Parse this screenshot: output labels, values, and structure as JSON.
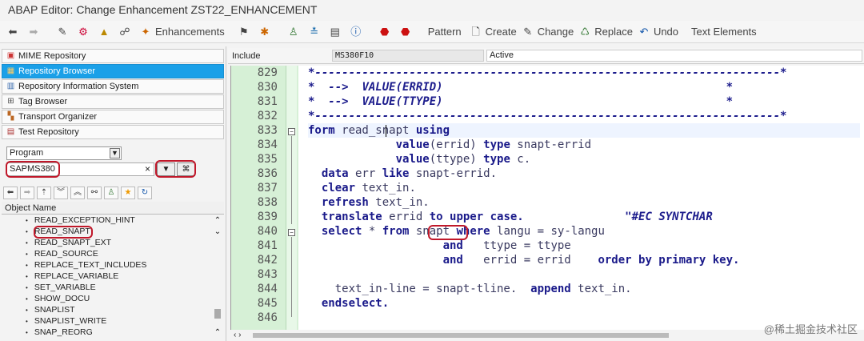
{
  "window": {
    "title": "ABAP Editor: Change Enhancement ZST22_ENHANCEMENT"
  },
  "toolbar": {
    "enhancements": "Enhancements",
    "pattern": "Pattern",
    "create": "Create",
    "change": "Change",
    "replace": "Replace",
    "undo": "Undo",
    "text_elements": "Text Elements"
  },
  "nav": [
    {
      "label": "MIME Repository",
      "icon": "mime-icon"
    },
    {
      "label": "Repository Browser",
      "icon": "repository-icon"
    },
    {
      "label": "Repository Information System",
      "icon": "info-system-icon"
    },
    {
      "label": "Tag Browser",
      "icon": "tag-icon"
    },
    {
      "label": "Transport Organizer",
      "icon": "transport-icon"
    },
    {
      "label": "Test Repository",
      "icon": "test-icon"
    }
  ],
  "object_type": {
    "selected": "Program"
  },
  "program_input": {
    "value": "SAPMS380"
  },
  "object_list": {
    "header": "Object Name",
    "items": [
      "READ_EXCEPTION_HINT",
      "READ_SNAPT",
      "READ_SNAPT_EXT",
      "READ_SOURCE",
      "REPLACE_TEXT_INCLUDES",
      "REPLACE_VARIABLE",
      "SET_VARIABLE",
      "SHOW_DOCU",
      "SNAPLIST",
      "SNAPLIST_WRITE",
      "SNAP_REORG"
    ]
  },
  "editor_info": {
    "include_label": "Include",
    "program": "MS380F10",
    "status": "Active"
  },
  "code": {
    "line_numbers": [
      "829",
      "830",
      "831",
      "832",
      "833",
      "834",
      "835",
      "836",
      "837",
      "838",
      "839",
      "840",
      "841",
      "842",
      "843",
      "844",
      "845",
      "846"
    ],
    "l829": "*---------------------------------------------------------------------*",
    "l830a": "*  -->  ",
    "l830b": "VALUE(ERRID)",
    "l830c": "                                          *",
    "l831a": "*  -->  ",
    "l831b": "VALUE(TTYPE)",
    "l831c": "                                          *",
    "l832": "*---------------------------------------------------------------------*",
    "l833_kw1": "form",
    "l833_id": " read_snapt ",
    "l833_kw2": "using",
    "l834_kw": "             value",
    "l834_rest": "(errid) ",
    "l834_kw2": "type",
    "l834_id": " snapt-errid",
    "l835_kw": "             value",
    "l835_rest": "(ttype) ",
    "l835_kw2": "type",
    "l835_id": " c.",
    "l836_kw": "  data",
    "l836_id": " err ",
    "l836_kw2": "like",
    "l836_id2": " snapt-errid.",
    "l837_kw": "  clear",
    "l837_id": " text_in.",
    "l838_kw": "  refresh",
    "l838_id": " text_in.",
    "l839_kw": "  translate",
    "l839_id": " errid ",
    "l839_kw2": "to upper case.",
    "l839_cm": "               \"#EC SYNTCHAR",
    "l840_kw": "  select",
    "l840_id": " * ",
    "l840_kw2": "from",
    "l840_id2": " snapt ",
    "l840_kw3": "where",
    "l840_id3": " langu = sy-langu",
    "l841_kw": "                    and",
    "l841_id": "   ttype = ttype",
    "l842_kw": "                    and",
    "l842_id": "   errid = errid    ",
    "l842_kw2": "order by primary key.",
    "l844_id": "    text_in-line = snapt-tline.  ",
    "l844_kw": "append",
    "l844_id2": " text_in.",
    "l845_kw": "  endselect."
  },
  "watermark": "@稀土掘金技术社区"
}
